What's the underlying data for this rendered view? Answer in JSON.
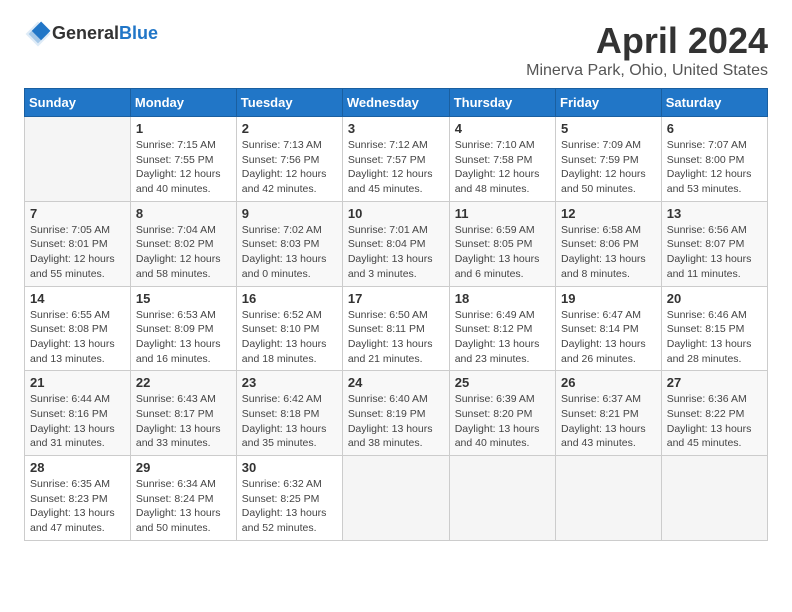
{
  "header": {
    "logo_general": "General",
    "logo_blue": "Blue",
    "title": "April 2024",
    "subtitle": "Minerva Park, Ohio, United States"
  },
  "calendar": {
    "days_of_week": [
      "Sunday",
      "Monday",
      "Tuesday",
      "Wednesday",
      "Thursday",
      "Friday",
      "Saturday"
    ],
    "weeks": [
      [
        {
          "day": "",
          "info": ""
        },
        {
          "day": "1",
          "info": "Sunrise: 7:15 AM\nSunset: 7:55 PM\nDaylight: 12 hours\nand 40 minutes."
        },
        {
          "day": "2",
          "info": "Sunrise: 7:13 AM\nSunset: 7:56 PM\nDaylight: 12 hours\nand 42 minutes."
        },
        {
          "day": "3",
          "info": "Sunrise: 7:12 AM\nSunset: 7:57 PM\nDaylight: 12 hours\nand 45 minutes."
        },
        {
          "day": "4",
          "info": "Sunrise: 7:10 AM\nSunset: 7:58 PM\nDaylight: 12 hours\nand 48 minutes."
        },
        {
          "day": "5",
          "info": "Sunrise: 7:09 AM\nSunset: 7:59 PM\nDaylight: 12 hours\nand 50 minutes."
        },
        {
          "day": "6",
          "info": "Sunrise: 7:07 AM\nSunset: 8:00 PM\nDaylight: 12 hours\nand 53 minutes."
        }
      ],
      [
        {
          "day": "7",
          "info": "Sunrise: 7:05 AM\nSunset: 8:01 PM\nDaylight: 12 hours\nand 55 minutes."
        },
        {
          "day": "8",
          "info": "Sunrise: 7:04 AM\nSunset: 8:02 PM\nDaylight: 12 hours\nand 58 minutes."
        },
        {
          "day": "9",
          "info": "Sunrise: 7:02 AM\nSunset: 8:03 PM\nDaylight: 13 hours\nand 0 minutes."
        },
        {
          "day": "10",
          "info": "Sunrise: 7:01 AM\nSunset: 8:04 PM\nDaylight: 13 hours\nand 3 minutes."
        },
        {
          "day": "11",
          "info": "Sunrise: 6:59 AM\nSunset: 8:05 PM\nDaylight: 13 hours\nand 6 minutes."
        },
        {
          "day": "12",
          "info": "Sunrise: 6:58 AM\nSunset: 8:06 PM\nDaylight: 13 hours\nand 8 minutes."
        },
        {
          "day": "13",
          "info": "Sunrise: 6:56 AM\nSunset: 8:07 PM\nDaylight: 13 hours\nand 11 minutes."
        }
      ],
      [
        {
          "day": "14",
          "info": "Sunrise: 6:55 AM\nSunset: 8:08 PM\nDaylight: 13 hours\nand 13 minutes."
        },
        {
          "day": "15",
          "info": "Sunrise: 6:53 AM\nSunset: 8:09 PM\nDaylight: 13 hours\nand 16 minutes."
        },
        {
          "day": "16",
          "info": "Sunrise: 6:52 AM\nSunset: 8:10 PM\nDaylight: 13 hours\nand 18 minutes."
        },
        {
          "day": "17",
          "info": "Sunrise: 6:50 AM\nSunset: 8:11 PM\nDaylight: 13 hours\nand 21 minutes."
        },
        {
          "day": "18",
          "info": "Sunrise: 6:49 AM\nSunset: 8:12 PM\nDaylight: 13 hours\nand 23 minutes."
        },
        {
          "day": "19",
          "info": "Sunrise: 6:47 AM\nSunset: 8:14 PM\nDaylight: 13 hours\nand 26 minutes."
        },
        {
          "day": "20",
          "info": "Sunrise: 6:46 AM\nSunset: 8:15 PM\nDaylight: 13 hours\nand 28 minutes."
        }
      ],
      [
        {
          "day": "21",
          "info": "Sunrise: 6:44 AM\nSunset: 8:16 PM\nDaylight: 13 hours\nand 31 minutes."
        },
        {
          "day": "22",
          "info": "Sunrise: 6:43 AM\nSunset: 8:17 PM\nDaylight: 13 hours\nand 33 minutes."
        },
        {
          "day": "23",
          "info": "Sunrise: 6:42 AM\nSunset: 8:18 PM\nDaylight: 13 hours\nand 35 minutes."
        },
        {
          "day": "24",
          "info": "Sunrise: 6:40 AM\nSunset: 8:19 PM\nDaylight: 13 hours\nand 38 minutes."
        },
        {
          "day": "25",
          "info": "Sunrise: 6:39 AM\nSunset: 8:20 PM\nDaylight: 13 hours\nand 40 minutes."
        },
        {
          "day": "26",
          "info": "Sunrise: 6:37 AM\nSunset: 8:21 PM\nDaylight: 13 hours\nand 43 minutes."
        },
        {
          "day": "27",
          "info": "Sunrise: 6:36 AM\nSunset: 8:22 PM\nDaylight: 13 hours\nand 45 minutes."
        }
      ],
      [
        {
          "day": "28",
          "info": "Sunrise: 6:35 AM\nSunset: 8:23 PM\nDaylight: 13 hours\nand 47 minutes."
        },
        {
          "day": "29",
          "info": "Sunrise: 6:34 AM\nSunset: 8:24 PM\nDaylight: 13 hours\nand 50 minutes."
        },
        {
          "day": "30",
          "info": "Sunrise: 6:32 AM\nSunset: 8:25 PM\nDaylight: 13 hours\nand 52 minutes."
        },
        {
          "day": "",
          "info": ""
        },
        {
          "day": "",
          "info": ""
        },
        {
          "day": "",
          "info": ""
        },
        {
          "day": "",
          "info": ""
        }
      ]
    ]
  }
}
